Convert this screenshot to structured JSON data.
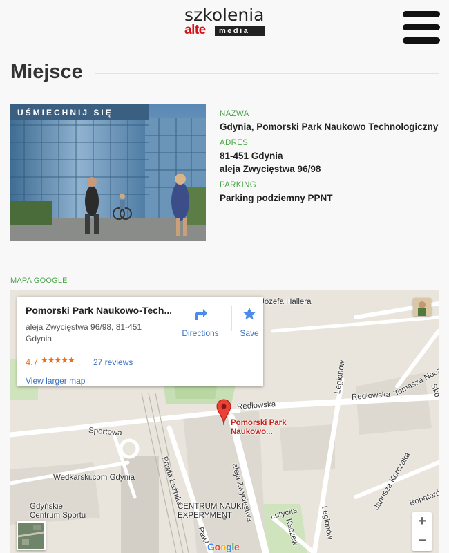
{
  "header": {
    "logo_top": "szkolenia",
    "logo_alte": "alte",
    "logo_media": "media",
    "menu_icon": "hamburger-menu-icon"
  },
  "page": {
    "title": "Miejsce"
  },
  "venue": {
    "photo_sign_text": "UŚMIECHNIJ SIĘ",
    "name_label": "NAZWA",
    "name": "Gdynia, Pomorski Park Naukowo Technologiczny",
    "address_label": "ADRES",
    "address_line1": "81-451 Gdynia",
    "address_line2": "aleja Zwycięstwa 96/98",
    "parking_label": "PARKING",
    "parking": "Parking podziemny PPNT"
  },
  "map": {
    "section_label": "MAPA GOOGLE",
    "card": {
      "title": "Pomorski Park Naukowo-Tech...",
      "address": "aleja Zwycięstwa 96/98, 81-451 Gdynia",
      "rating": "4.7",
      "stars": "★★★★★",
      "reviews": "27 reviews",
      "larger_map": "View larger map",
      "directions": "Directions",
      "save": "Save"
    },
    "pin_label_line1": "Pomorski Park",
    "pin_label_line2": "Naukowo...",
    "streets": {
      "hallera": "Józefa Hallera",
      "redlowska1": "Redłowska",
      "redlowska2": "Redłowska",
      "tomasza": "Tomasza Nocz",
      "sportowa": "Sportowa",
      "pawla": "Pawła Łaźnika",
      "zwyciestwa": "aleja Zwycięstwa",
      "legionow1": "Legionów",
      "legionow2": "Legionów",
      "janusza": "Janusza Korczaka",
      "bohaterow": "Bohateró",
      "lutycka": "Lutycka",
      "kaczew": "Kaczew",
      "pawla2": "Pawł",
      "wedkarski": "Wedkarski.com Gdynia",
      "gdynskie1": "Gdyńskie",
      "gdynskie2": "Centrum Sportu",
      "centrum1": "CENTRUM NAUKI",
      "centrum2": "EXPERYMENT",
      "sko": "Sko"
    },
    "zoom_in": "+",
    "zoom_out": "−",
    "google": [
      "G",
      "o",
      "o",
      "g",
      "l",
      "e"
    ]
  },
  "colors": {
    "accent_green": "#4aa54a",
    "brand_red": "#d5141a",
    "link_blue": "#3a70c2",
    "rating_orange": "#e7711b",
    "pin_red": "#ea4335"
  }
}
